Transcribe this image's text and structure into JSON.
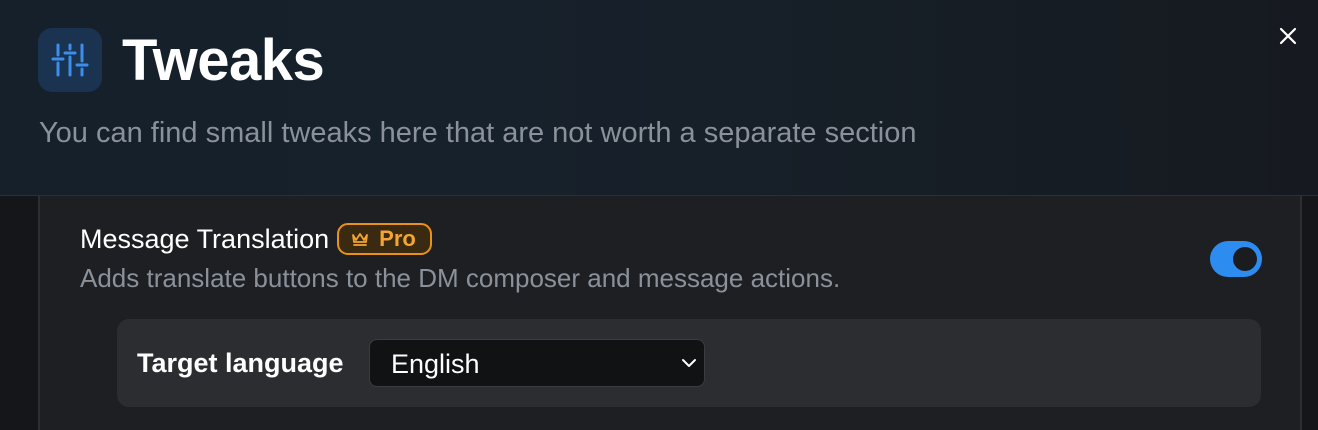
{
  "header": {
    "title": "Tweaks",
    "subtitle": "You can find small tweaks here that are not worth a separate section",
    "icon": "sliders-icon",
    "close_icon": "close-icon"
  },
  "setting": {
    "title": "Message Translation",
    "badge": {
      "label": "Pro",
      "icon": "crown-icon"
    },
    "description": "Adds translate buttons to the DM composer and message actions.",
    "enabled": true
  },
  "sub_setting": {
    "label": "Target language",
    "selected": "English"
  },
  "colors": {
    "accent": "#2d8cf0",
    "pro": "#f2a531"
  }
}
